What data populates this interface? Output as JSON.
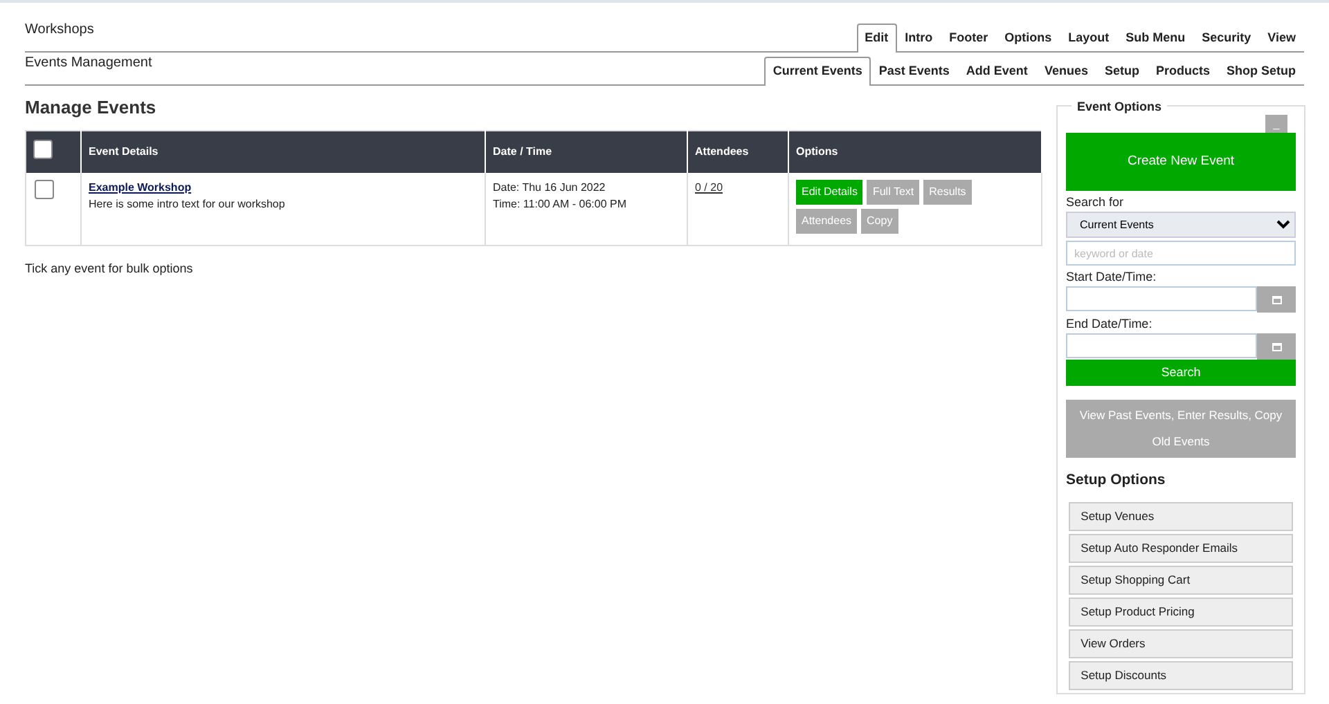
{
  "header": {
    "title": "Workshops",
    "tabs": [
      {
        "label": "Edit",
        "selected": true
      },
      {
        "label": "Intro",
        "selected": false
      },
      {
        "label": "Footer",
        "selected": false
      },
      {
        "label": "Options",
        "selected": false
      },
      {
        "label": "Layout",
        "selected": false
      },
      {
        "label": "Sub Menu",
        "selected": false
      },
      {
        "label": "Security",
        "selected": false
      },
      {
        "label": "View",
        "selected": false
      }
    ]
  },
  "subheader": {
    "title": "Events Management",
    "tabs": [
      {
        "label": "Current Events",
        "selected": true
      },
      {
        "label": "Past Events",
        "selected": false
      },
      {
        "label": "Add Event",
        "selected": false
      },
      {
        "label": "Venues",
        "selected": false
      },
      {
        "label": "Setup",
        "selected": false
      },
      {
        "label": "Products",
        "selected": false
      },
      {
        "label": "Shop Setup",
        "selected": false
      }
    ]
  },
  "main": {
    "heading": "Manage Events",
    "table": {
      "select_all_checked": false,
      "columns": [
        "Event Details",
        "Date / Time",
        "Attendees",
        "Options"
      ],
      "rows": [
        {
          "checked": false,
          "title": "Example Workshop",
          "intro": "Here is some intro text for our workshop",
          "date": "Date: Thu 16 Jun 2022",
          "time": "Time: 11:00 AM - 06:00 PM",
          "attendees": "0 / 20",
          "options": [
            {
              "label": "Edit Details",
              "kind": "primary"
            },
            {
              "label": "Full Text",
              "kind": "secondary"
            },
            {
              "label": "Results",
              "kind": "secondary"
            },
            {
              "label": "Attendees",
              "kind": "secondary"
            },
            {
              "label": "Copy",
              "kind": "secondary"
            }
          ]
        }
      ]
    },
    "note": "Tick any event for bulk options"
  },
  "sidebar": {
    "legend": "Event Options",
    "collapse": "_",
    "create_button": "Create New Event",
    "search_label": "Search for",
    "search_select": "Current Events",
    "keyword_placeholder": "keyword or date",
    "start_label": "Start Date/Time:",
    "end_label": "End Date/Time:",
    "search_button": "Search",
    "past_button": "View Past Events, Enter Results, Copy Old Events",
    "setup_heading": "Setup Options",
    "setup_items": [
      "Setup Venues",
      "Setup Auto Responder Emails",
      "Setup Shopping Cart",
      "Setup Product Pricing",
      "View Orders",
      "Setup Discounts"
    ]
  }
}
